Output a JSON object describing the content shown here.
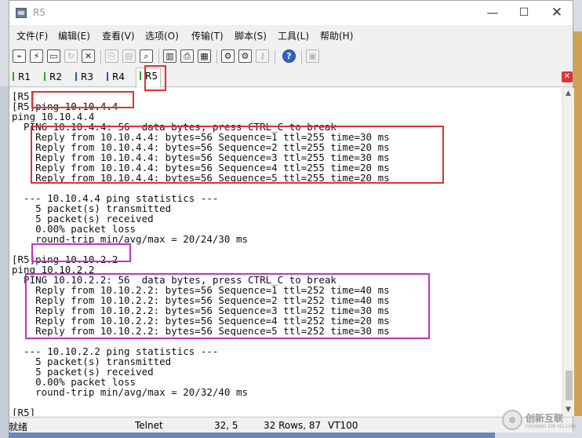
{
  "window": {
    "title": "R5",
    "controls": {
      "minimize": "—",
      "maximize": "☐",
      "close": "✕"
    }
  },
  "menu": [
    {
      "label": "文件(F)"
    },
    {
      "label": "编辑(E)"
    },
    {
      "label": "查看(V)"
    },
    {
      "label": "选项(O)"
    },
    {
      "label": "传输(T)"
    },
    {
      "label": "脚本(S)"
    },
    {
      "label": "工具(L)"
    },
    {
      "label": "帮助(H)"
    }
  ],
  "toolbar": {
    "icons": [
      "connect-icon",
      "quick-connect-icon",
      "connect-tab-icon",
      "reconnect-icon",
      "disconnect-icon",
      "copy-icon",
      "paste-icon",
      "find-icon",
      "print-setup-icon",
      "print-icon",
      "print-screen-icon",
      "session-options-icon",
      "global-options-icon",
      "keymap-icon",
      "help-icon",
      "sftp-icon"
    ],
    "glyphs": [
      "⌁",
      "⚡",
      "▭",
      "↻",
      "✕",
      "⎘",
      "▤",
      "⌕",
      "▥",
      "⎙",
      "▦",
      "⚙",
      "⚙",
      "⚷",
      "?",
      "▣"
    ]
  },
  "tabs": [
    {
      "label": "R1",
      "color": "#2ba32b",
      "active": false
    },
    {
      "label": "R2",
      "color": "#2ba32b",
      "active": false
    },
    {
      "label": "R3",
      "color": "#2a52c8",
      "active": false
    },
    {
      "label": "R4",
      "color": "#2a52c8",
      "active": false
    },
    {
      "label": "R5",
      "color": "#2ba32b",
      "active": true
    }
  ],
  "tab_close": "✕",
  "terminal": {
    "lines": [
      "[R5]",
      "[R5]ping 10.10.4.4",
      "ping 10.10.4.4",
      "  PING 10.10.4.4: 56  data bytes, press CTRL_C to break",
      "    Reply from 10.10.4.4: bytes=56 Sequence=1 ttl=255 time=30 ms",
      "    Reply from 10.10.4.4: bytes=56 Sequence=2 ttl=255 time=20 ms",
      "    Reply from 10.10.4.4: bytes=56 Sequence=3 ttl=255 time=30 ms",
      "    Reply from 10.10.4.4: bytes=56 Sequence=4 ttl=255 time=20 ms",
      "    Reply from 10.10.4.4: bytes=56 Sequence=5 ttl=255 time=20 ms",
      "",
      "  --- 10.10.4.4 ping statistics ---",
      "    5 packet(s) transmitted",
      "    5 packet(s) received",
      "    0.00% packet loss",
      "    round-trip min/avg/max = 20/24/30 ms",
      "",
      "[R5]ping 10.10.2.2",
      "ping 10.10.2.2",
      "  PING 10.10.2.2: 56  data bytes, press CTRL_C to break",
      "    Reply from 10.10.2.2: bytes=56 Sequence=1 ttl=252 time=40 ms",
      "    Reply from 10.10.2.2: bytes=56 Sequence=2 ttl=252 time=40 ms",
      "    Reply from 10.10.2.2: bytes=56 Sequence=3 ttl=252 time=30 ms",
      "    Reply from 10.10.2.2: bytes=56 Sequence=4 ttl=252 time=20 ms",
      "    Reply from 10.10.2.2: bytes=56 Sequence=5 ttl=252 time=30 ms",
      "",
      "  --- 10.10.2.2 ping statistics ---",
      "    5 packet(s) transmitted",
      "    5 packet(s) received",
      "    0.00% packet loss",
      "    round-trip min/avg/max = 20/32/40 ms",
      "",
      "[R5]"
    ]
  },
  "annotations": [
    {
      "color": "#e03131"
    },
    {
      "color": "#e03131"
    },
    {
      "color": "#e03131"
    },
    {
      "color": "#c233c8"
    },
    {
      "color": "#c233c8"
    }
  ],
  "status": {
    "ready": "就绪",
    "protocol": "Telnet",
    "cursor_pos": "32,   5",
    "rows": "32 Rows, 87",
    "terminal_type": "VT100"
  },
  "watermark": {
    "text": "创新互联",
    "subtext": "CHUANG XIN HU LIAN"
  }
}
